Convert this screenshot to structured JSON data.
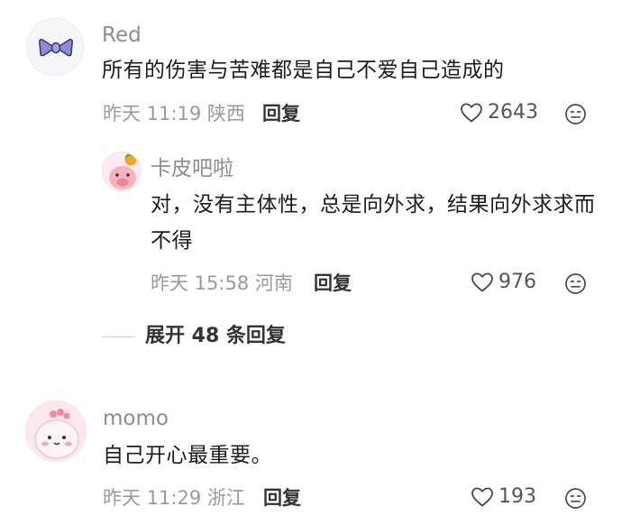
{
  "comments": [
    {
      "username": "Red",
      "content": "所有的伤害与苦难都是自己不爱自己造成的",
      "time": "昨天 11:19",
      "location": "陕西",
      "reply_label": "回复",
      "likes": "2643",
      "replies": [
        {
          "username": "卡皮吧啦",
          "content": "对，没有主体性，总是向外求，结果向外求求而不得",
          "time": "昨天 15:58",
          "location": "河南",
          "reply_label": "回复",
          "likes": "976"
        }
      ],
      "expand_label": "展开 48 条回复"
    },
    {
      "username": "momo",
      "content": "自己开心最重要。",
      "time": "昨天 11:29",
      "location": "浙江",
      "reply_label": "回复",
      "likes": "193"
    }
  ],
  "icons": {
    "like": "heart-outline-icon",
    "emoji": "smiley-face-icon"
  },
  "colors": {
    "username": "#8d8d8d",
    "content": "#1c1c1c",
    "meta": "#9a9a9a",
    "action": "#333333"
  }
}
